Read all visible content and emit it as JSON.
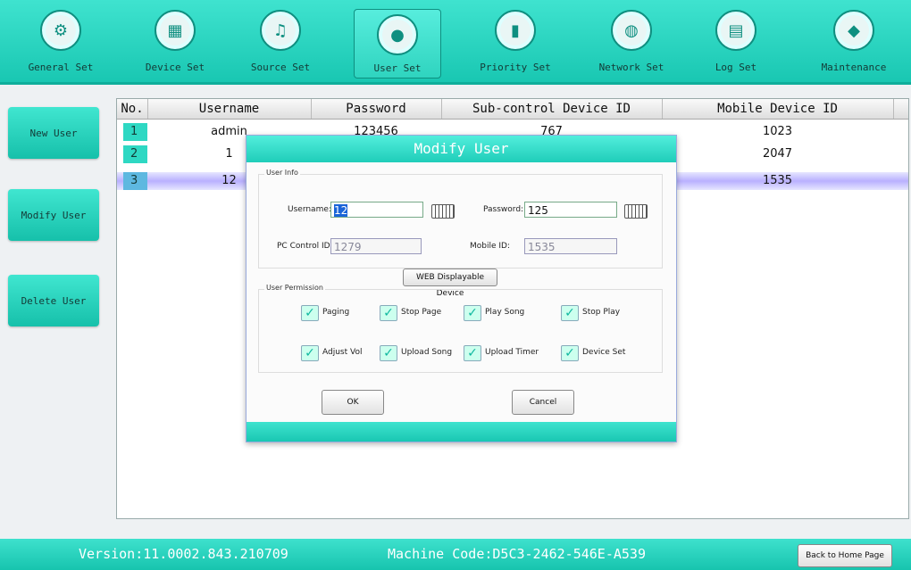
{
  "nav": [
    {
      "label": "General Set",
      "icon": "gear-icon",
      "glyph": "⚙"
    },
    {
      "label": "Device Set",
      "icon": "grid-icon",
      "glyph": "▦"
    },
    {
      "label": "Source Set",
      "icon": "music-icon",
      "glyph": "♫"
    },
    {
      "label": "User Set",
      "icon": "user-icon",
      "glyph": "●"
    },
    {
      "label": "Priority Set",
      "icon": "bar-chart-icon",
      "glyph": "▮"
    },
    {
      "label": "Network Set",
      "icon": "globe-icon",
      "glyph": "◍"
    },
    {
      "label": "Log Set",
      "icon": "calendar-icon",
      "glyph": "▤"
    },
    {
      "label": "Maintenance",
      "icon": "shield-icon",
      "glyph": "◆"
    }
  ],
  "sidebar": {
    "new_user": "New User",
    "modify_user": "Modify User",
    "delete_user": "Delete User"
  },
  "table": {
    "headers": [
      "No.",
      "Username",
      "Password",
      "Sub-control Device ID",
      "Mobile Device ID"
    ],
    "rows": [
      {
        "no": "1",
        "username": "admin",
        "password": "123456",
        "sub": "767",
        "mobile": "1023"
      },
      {
        "no": "2",
        "username": "1",
        "password": "",
        "sub": "",
        "mobile": "2047"
      },
      {
        "no": "3",
        "username": "12",
        "password": "",
        "sub": "",
        "mobile": "1535"
      }
    ]
  },
  "dialog": {
    "title": "Modify User",
    "user_info_label": "User Info",
    "username_label": "Username:",
    "username_value": "12",
    "password_label": "Password:",
    "password_value": "125",
    "pc_control_label": "PC Control ID:",
    "pc_control_value": "1279",
    "mobile_id_label": "Mobile ID:",
    "mobile_id_value": "1535",
    "web_button": "WEB Displayable Device",
    "permission_label": "User Permission",
    "permissions": [
      "Paging",
      "Stop Page",
      "Play Song",
      "Stop Play",
      "Adjust Vol",
      "Upload Song",
      "Upload Timer",
      "Device Set"
    ],
    "ok": "OK",
    "cancel": "Cancel"
  },
  "footer": {
    "version": "Version:11.0002.843.210709",
    "machine": "Machine Code:D5C3-2462-546E-A539",
    "home": "Back to Home Page"
  },
  "colors": {
    "accent": "#19c7b2",
    "selected_row": "#b9b0ff",
    "highlight": "#1a64d8"
  }
}
